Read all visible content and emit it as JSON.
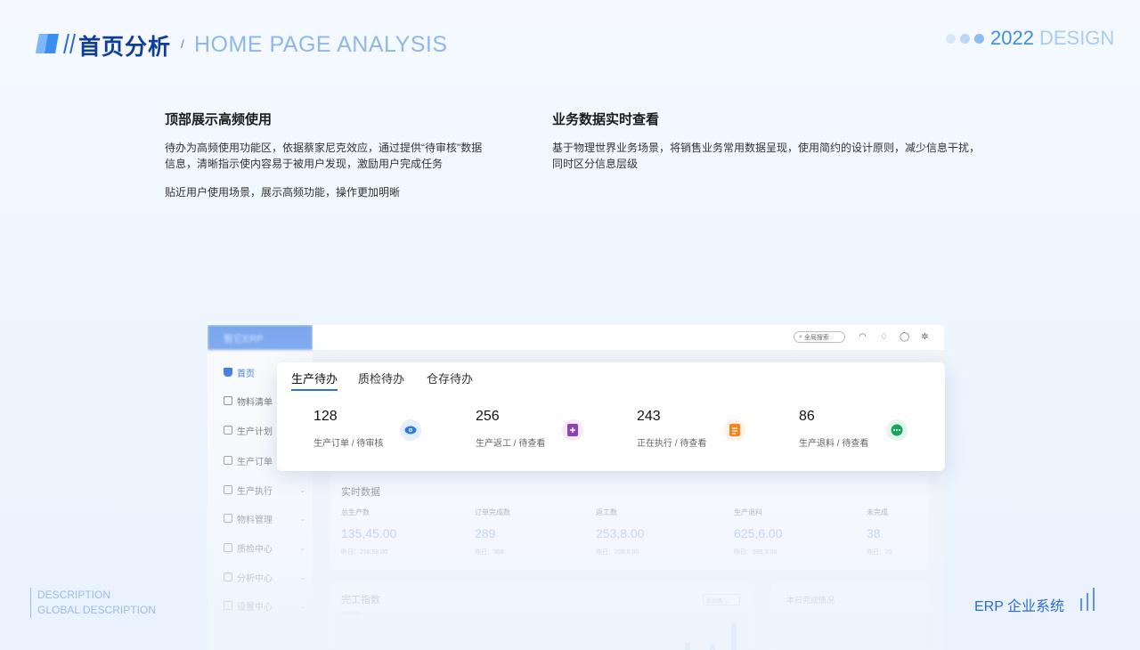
{
  "header": {
    "title": "首页分析",
    "slash": "/",
    "subtitle": "HOME PAGE ANALYSIS",
    "year": "2022",
    "design": "DESIGN"
  },
  "intro": {
    "left": {
      "heading": "顶部展示高频使用",
      "para1": "待办为高频使用功能区，依据蔡家尼克效应，通过提供“待审核\"数据信息，清晰指示使内容易于被用户发现，激励用户完成任务",
      "para2": "贴近用户使用场景，展示高频功能，操作更加明晰"
    },
    "right": {
      "heading": "业务数据实时查看",
      "para1": "基于物理世界业务场景，将销售业务常用数据呈现，使用简约的设计原则，减少信息干扰，同时区分信息层级"
    }
  },
  "app": {
    "logo": "智它ERP",
    "search_placeholder": "全局搜索",
    "sidebar": [
      {
        "label": "首页",
        "icon": "home-icon",
        "active": true
      },
      {
        "label": "物料清单",
        "icon": "list-icon"
      },
      {
        "label": "生产计划",
        "icon": "calendar-icon"
      },
      {
        "label": "生产订单",
        "icon": "order-icon"
      },
      {
        "label": "生产执行",
        "icon": "doc-icon",
        "arrow": "⌄"
      },
      {
        "label": "物料管理",
        "icon": "box-icon",
        "arrow": "⌄"
      },
      {
        "label": "质检中心",
        "icon": "check-icon",
        "arrow": "⌄"
      },
      {
        "label": "分析中心",
        "icon": "chart-icon",
        "arrow": "⌄"
      },
      {
        "label": "设置中心",
        "icon": "gear-icon",
        "arrow": "⌄"
      }
    ],
    "tabs": [
      "生产待办",
      "质检待办",
      "仓存待办"
    ],
    "todos": [
      {
        "value": "128",
        "label": "生产订单 / 待审核",
        "icon": "eye-icon",
        "color": "#2c7be5"
      },
      {
        "value": "256",
        "label": "生产返工 / 待查看",
        "icon": "add-file-icon",
        "color": "#8e44ad"
      },
      {
        "value": "243",
        "label": "正在执行 / 待查看",
        "icon": "doc-icon",
        "color": "#f5841f"
      },
      {
        "value": "86",
        "label": "生产退料 / 待查看",
        "icon": "chat-icon",
        "color": "#1aa35a"
      }
    ],
    "realtime": {
      "title": "实时数据",
      "items": [
        {
          "label": "总生产数",
          "value": "135,45.00",
          "sub": "昨日：216,58.00"
        },
        {
          "label": "订单完成数",
          "value": "289",
          "sub": "昨日：368"
        },
        {
          "label": "返工数",
          "value": "253,8.00",
          "sub": "昨日：255,6.00"
        },
        {
          "label": "生产退料",
          "value": "625,6.00",
          "sub": "昨日：596,3.00"
        },
        {
          "label": "未完成",
          "value": "38",
          "sub": "昨日：25"
        }
      ]
    },
    "chart_panel": {
      "title": "完工指数",
      "select": "近30天 ⌄",
      "axis": "200,000"
    },
    "today_panel": {
      "title": "本日完成情况"
    }
  },
  "footer": {
    "desc1": "DESCRIPTION",
    "desc2": "GLOBAL DESCRIPTION",
    "product": "ERP 企业系统"
  },
  "colors": {
    "brand": "#0d3f9a",
    "accent": "#2f6fe0"
  }
}
